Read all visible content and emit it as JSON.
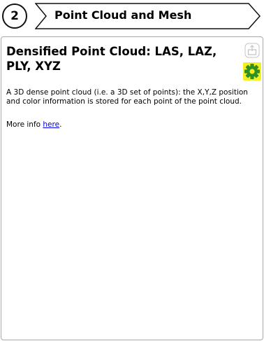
{
  "step": {
    "number": "2",
    "title": "Point Cloud and Mesh"
  },
  "panel": {
    "title": "Densified Point Cloud: LAS, LAZ, PLY, XYZ",
    "description": "A 3D dense point cloud (i.e. a 3D set of points): the X,Y,Z position and color information is stored for each point of the point cloud.",
    "more_info_prefix": "More info ",
    "more_info_link": "here",
    "more_info_suffix": "."
  },
  "icons": {
    "export": "export-icon",
    "settings": "gear-icon"
  },
  "colors": {
    "settings_highlight": "#f2ef24",
    "gear": "#2f8f1f",
    "link": "#0000ee"
  }
}
